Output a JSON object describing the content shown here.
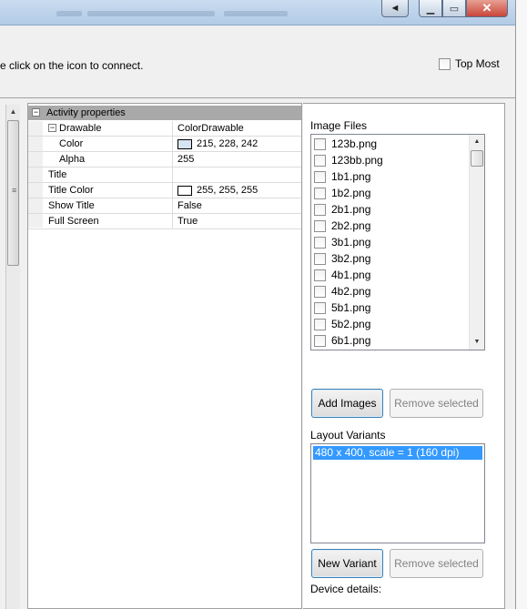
{
  "window": {
    "back_glyph": "◄",
    "minimize_glyph": "▁",
    "maximize_glyph": "▭",
    "close_glyph": "✕"
  },
  "header": {
    "hint_text": "e click on the icon to connect.",
    "top_most_label": "Top Most",
    "top_most_checked": false
  },
  "property_grid": {
    "category": "Activity properties",
    "rows": [
      {
        "name": "Drawable",
        "value": "ColorDrawable",
        "expander": "−"
      },
      {
        "name": "Color",
        "value": "215, 228, 242",
        "swatch": "#d7e4f2"
      },
      {
        "name": "Alpha",
        "value": "255"
      },
      {
        "name": "Title",
        "value": ""
      },
      {
        "name": "Title Color",
        "value": "255, 255, 255",
        "swatch": "#ffffff"
      },
      {
        "name": "Show Title",
        "value": "False"
      },
      {
        "name": "Full Screen",
        "value": "True"
      }
    ]
  },
  "image_files": {
    "label": "Image Files",
    "items": [
      "123b.png",
      "123bb.png",
      "1b1.png",
      "1b2.png",
      "2b1.png",
      "2b2.png",
      "3b1.png",
      "3b2.png",
      "4b1.png",
      "4b2.png",
      "5b1.png",
      "5b2.png",
      "6b1.png"
    ],
    "add_button": "Add Images",
    "remove_button": "Remove selected"
  },
  "layout_variants": {
    "label": "Layout Variants",
    "items": [
      "480 x 400, scale = 1 (160 dpi)"
    ],
    "new_button": "New Variant",
    "remove_button": "Remove selected"
  },
  "device_details": {
    "label": "Device details:"
  },
  "colors": {
    "selection": "#3399ff",
    "category_bg": "#a9a9a9",
    "close_button": "#c9453a"
  }
}
